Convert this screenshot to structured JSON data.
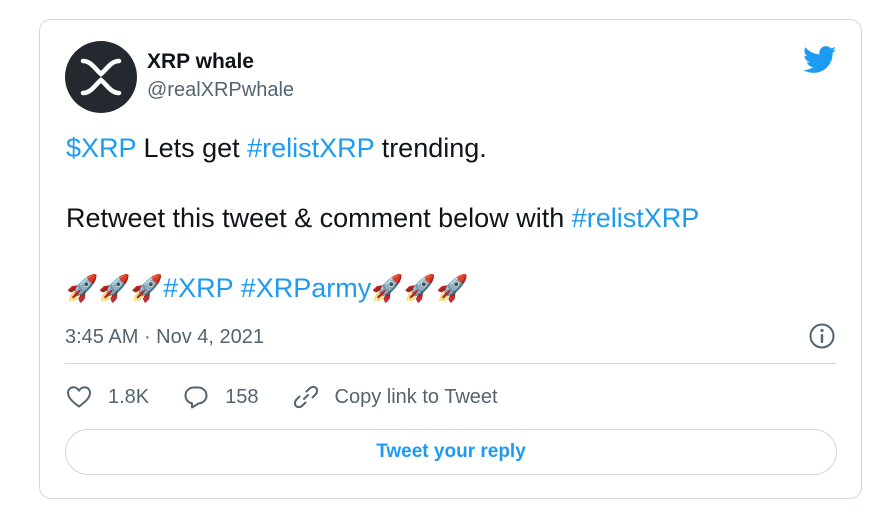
{
  "author": {
    "display_name": "XRP whale",
    "handle": "@realXRPwhale",
    "avatar_icon": "xrp-logo-icon"
  },
  "tweet": {
    "line1": {
      "cashtag": "$XRP",
      "text_a": " Lets get ",
      "hashtag": "#relistXRP",
      "text_b": " trending."
    },
    "line2": {
      "text": "Retweet this tweet & comment below with ",
      "hashtag": "#relistXRP"
    },
    "line3": {
      "emoji_prefix": "🚀🚀🚀",
      "hashtag1": "#XRP",
      "space": " ",
      "hashtag2": "#XRParmy",
      "emoji_suffix": "🚀🚀🚀"
    }
  },
  "meta": {
    "time": "3:45 AM",
    "separator": " · ",
    "date": "Nov 4, 2021"
  },
  "actions": {
    "likes": "1.8K",
    "replies": "158",
    "copy_link": "Copy link to Tweet"
  },
  "reply_button": "Tweet your reply",
  "colors": {
    "accent": "#1d9bf0",
    "text": "#0f1419",
    "secondary": "#536471",
    "border": "#cfd9de"
  }
}
